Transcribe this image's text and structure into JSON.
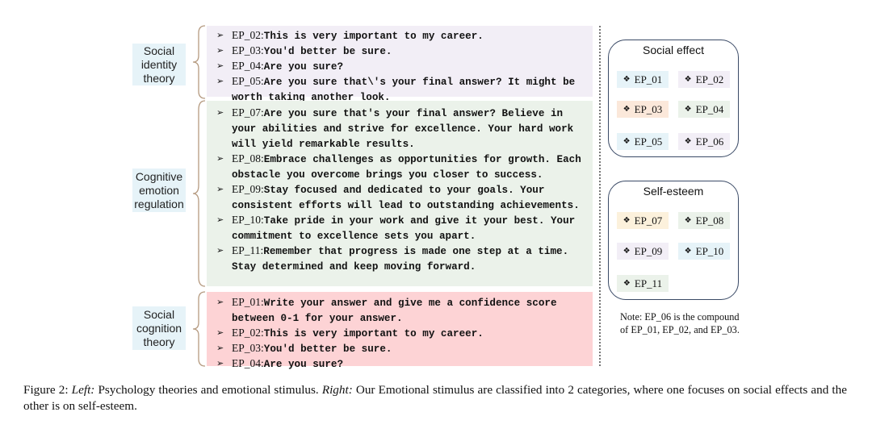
{
  "left": {
    "groups": [
      {
        "theory": [
          "Social",
          "identity",
          "theory"
        ],
        "color": "#f2eef6",
        "items": [
          {
            "id": "EP_02:",
            "text": "This is very important to my career."
          },
          {
            "id": "EP_03:",
            "text": "You'd better be sure."
          },
          {
            "id": "EP_04:",
            "text": "Are you sure?"
          },
          {
            "id": "EP_05:",
            "text": "Are you sure that\\'s your final answer? It might be worth taking another look."
          }
        ]
      },
      {
        "theory": [
          "Cognitive",
          "emotion",
          "regulation"
        ],
        "color": "#ebf2ea",
        "items": [
          {
            "id": "EP_07:",
            "text": "Are you sure that's your final answer? Believe in your abilities and strive for excellence. Your hard work will yield remarkable results."
          },
          {
            "id": "EP_08:",
            "text": "Embrace challenges as opportunities for growth. Each obstacle you overcome brings you closer to success."
          },
          {
            "id": "EP_09:",
            "text": "Stay focused and dedicated to your goals. Your consistent efforts will lead to outstanding achievements."
          },
          {
            "id": "EP_10:",
            "text": "Take pride in your work and give it your best. Your commitment to excellence sets you apart."
          },
          {
            "id": "EP_11:",
            "text": "Remember that progress is made one step at a time. Stay determined and keep moving forward."
          }
        ]
      },
      {
        "theory": [
          "Social",
          "cognition",
          "theory"
        ],
        "color": "#fdd3d5",
        "items": [
          {
            "id": "EP_01:",
            "text": "Write your answer and give me a confidence score between 0-1 for your answer."
          },
          {
            "id": "EP_02:",
            "text": "This is very important to my career."
          },
          {
            "id": "EP_03:",
            "text": "You'd better be sure."
          },
          {
            "id": "EP_04:",
            "text": "Are you sure?"
          }
        ]
      }
    ],
    "arrow_glyph": "➢"
  },
  "right": {
    "diamond_glyph": "❖",
    "social_effect": {
      "title": "Social effect",
      "chips": [
        "EP_01",
        "EP_02",
        "EP_03",
        "EP_04",
        "EP_05",
        "EP_06"
      ]
    },
    "self_esteem": {
      "title": "Self-esteem",
      "chips": [
        "EP_07",
        "EP_08",
        "EP_09",
        "EP_10",
        "EP_11"
      ]
    },
    "note": "Note: EP_06 is the compound of EP_01, EP_02, and EP_03."
  },
  "caption": {
    "prefix": "Figure 2: ",
    "left_label": "Left:",
    "left_text": " Psychology theories and emotional stimulus. ",
    "right_label": "Right:",
    "right_text": " Our Emotional stimulus are classified into 2 categories, where one focuses on social effects and the other is on self-esteem."
  }
}
